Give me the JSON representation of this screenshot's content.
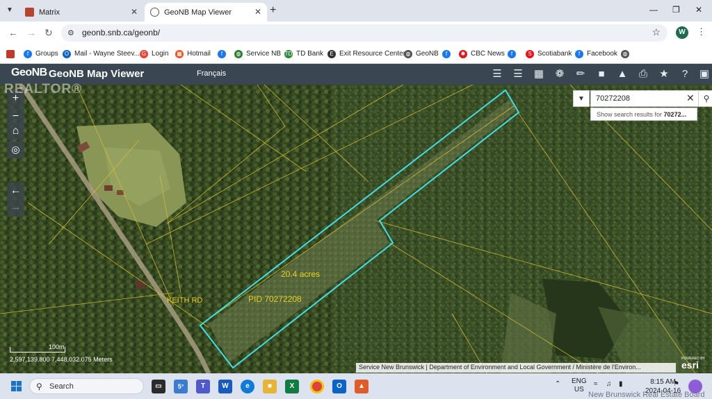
{
  "browser": {
    "tabs": [
      {
        "label": "Matrix",
        "active": false
      },
      {
        "label": "GeoNB Map Viewer",
        "active": true
      }
    ],
    "url": "geonb.snb.ca/geonb/",
    "profile_initial": "W"
  },
  "bookmarks": [
    {
      "label": "Groups",
      "icon": "facebook-icon",
      "color": "#1877f2"
    },
    {
      "label": "Mail - Wayne Steev...",
      "icon": "outlook-icon",
      "color": "#0a64c8"
    },
    {
      "label": "Login",
      "icon": "google-icon",
      "color": "#ea4335"
    },
    {
      "label": "Hotmail",
      "icon": "microsoft-icon",
      "color": "#f25022"
    },
    {
      "label": "",
      "icon": "facebook-icon",
      "color": "#1877f2"
    },
    {
      "label": "Service NB",
      "icon": "globe-icon",
      "color": "#2e7d32"
    },
    {
      "label": "TD Bank",
      "icon": "td-icon",
      "color": "#2e8b3e"
    },
    {
      "label": "Exit Resource Center",
      "icon": "exit-icon",
      "color": "#333333"
    },
    {
      "label": "GeoNB",
      "icon": "globe-icon",
      "color": "#555555"
    },
    {
      "label": "",
      "icon": "facebook-icon",
      "color": "#1877f2"
    },
    {
      "label": "CBC News",
      "icon": "cbc-icon",
      "color": "#d71920"
    },
    {
      "label": "",
      "icon": "facebook-icon",
      "color": "#1877f2"
    },
    {
      "label": "Scotiabank",
      "icon": "scotiabank-icon",
      "color": "#ec111a"
    },
    {
      "label": "Facebook",
      "icon": "facebook-icon",
      "color": "#1877f2"
    },
    {
      "label": "",
      "icon": "globe-icon",
      "color": "#555555"
    }
  ],
  "app": {
    "logo": "GeoNB",
    "title": "GeoNB Map Viewer",
    "language_link": "Français"
  },
  "search": {
    "value": "70272208",
    "suggestion_prefix": "Show search results for ",
    "suggestion_term": "70272..."
  },
  "map": {
    "acreage_label": "20.4 acres",
    "pid_label": "PID 70272208",
    "road_label": "KEITH RD",
    "scale_label": "100m",
    "coordinates": "2,597,139.800 7,448,032.075 Meters",
    "attribution": "Service New Brunswick | Department of Environment and Local Government / Ministère de l'Environ...",
    "esri_powered": "POWERED BY",
    "esri_logo": "esri",
    "parcel_color": "#3fe0e8",
    "boundary_color": "#d8c030"
  },
  "watermark": "REALTOR®",
  "board_watermark": "New Brunswick Real Estate Board",
  "taskbar": {
    "search_placeholder": "Search",
    "weather": "5°",
    "lang_top": "ENG",
    "lang_bottom": "US",
    "time": "8:15 AM",
    "date": "2024-04-16"
  }
}
